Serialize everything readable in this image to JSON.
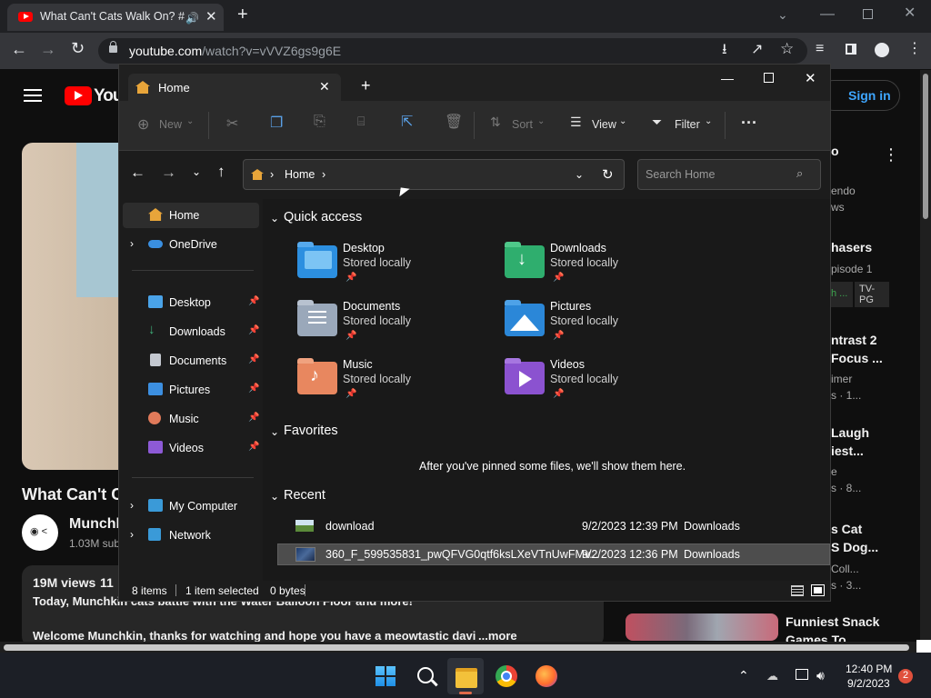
{
  "browser": {
    "tab_title": "What Can't Cats Walk On? #",
    "url_host": "youtube.com",
    "url_path": "/watch?v=vVVZ6gs9g6E"
  },
  "youtube": {
    "sign_in_label": "Sign in",
    "video_title_visible": "What Can't C",
    "channel_name_visible": "Munchk",
    "subs_visible": "1.03M sub",
    "views_label": "19M views",
    "views_extra": "11",
    "desc_line1": "Today, Munchkin cats battle with the Water Balloon Floor and more!",
    "desc_line2": "Welcome Munchkin, thanks for watching and hope you have a meowtastic davi",
    "more_label": "...more",
    "sidebar": [
      {
        "line1": "o",
        "line2": "endo",
        "line3": "ws"
      },
      {
        "line1": "hasers",
        "line2": "pisode 1",
        "badge1": "h ...",
        "badge2": "TV-\nPG"
      },
      {
        "line1": "ntrast 2",
        "line2": "Focus ...",
        "line3": "imer",
        "line4": "s · 1..."
      },
      {
        "line1": "Laugh",
        "line2": "iest...",
        "line3": "e",
        "line4": "s · 8..."
      },
      {
        "line1": "s Cat",
        "line2": "S Dog...",
        "line3": "Coll...",
        "line4": "s · 3..."
      },
      {
        "line1": "Funniest Snack",
        "line2": "Games To"
      }
    ]
  },
  "explorer": {
    "tab_title": "Home",
    "toolbar": {
      "new": "New",
      "sort": "Sort",
      "view": "View",
      "filter": "Filter",
      "more": "···"
    },
    "breadcrumb": "Home",
    "search_placeholder": "Search Home",
    "nav": {
      "home": "Home",
      "onedrive": "OneDrive",
      "pinned": [
        {
          "label": "Desktop",
          "icon": "desktop-icon",
          "color": "#4aa3e8"
        },
        {
          "label": "Downloads",
          "icon": "download-icon",
          "color": "#3fb07a"
        },
        {
          "label": "Documents",
          "icon": "document-icon",
          "color": "#c4c8d0"
        },
        {
          "label": "Pictures",
          "icon": "pictures-icon",
          "color": "#3c8fe0"
        },
        {
          "label": "Music",
          "icon": "music-icon",
          "color": "#e07a5a"
        },
        {
          "label": "Videos",
          "icon": "videos-icon",
          "color": "#8d5ad6"
        }
      ],
      "my_computer": "My Computer",
      "network": "Network"
    },
    "quick_access_title": "Quick access",
    "quick_access": [
      {
        "name": "Desktop",
        "sub": "Stored locally",
        "color": "#2c8fe0",
        "icon": "desktop-folder-icon"
      },
      {
        "name": "Downloads",
        "sub": "Stored locally",
        "color": "#2fae6e",
        "icon": "downloads-folder-icon"
      },
      {
        "name": "Documents",
        "sub": "Stored locally",
        "color": "#9aa8ba",
        "icon": "documents-folder-icon"
      },
      {
        "name": "Pictures",
        "sub": "Stored locally",
        "color": "#2b87d8",
        "icon": "pictures-folder-icon"
      },
      {
        "name": "Music",
        "sub": "Stored locally",
        "color": "#e8875f",
        "icon": "music-folder-icon"
      },
      {
        "name": "Videos",
        "sub": "Stored locally",
        "color": "#8b52d0",
        "icon": "videos-folder-icon"
      }
    ],
    "favorites_title": "Favorites",
    "favorites_empty": "After you've pinned some files, we'll show them here.",
    "recent_title": "Recent",
    "recent": [
      {
        "name": "download",
        "date": "9/2/2023 12:39 PM",
        "location": "Downloads",
        "selected": false
      },
      {
        "name": "360_F_599535831_pwQFVG0qtf6ksLXeVTnUwFMv...",
        "date": "9/2/2023 12:36 PM",
        "location": "Downloads",
        "selected": true
      }
    ],
    "status": {
      "items": "8 items",
      "selected": "1 item selected",
      "size": "0 bytes"
    }
  },
  "taskbar": {
    "time": "12:40 PM",
    "date": "9/2/2023",
    "notification_count": "2"
  }
}
